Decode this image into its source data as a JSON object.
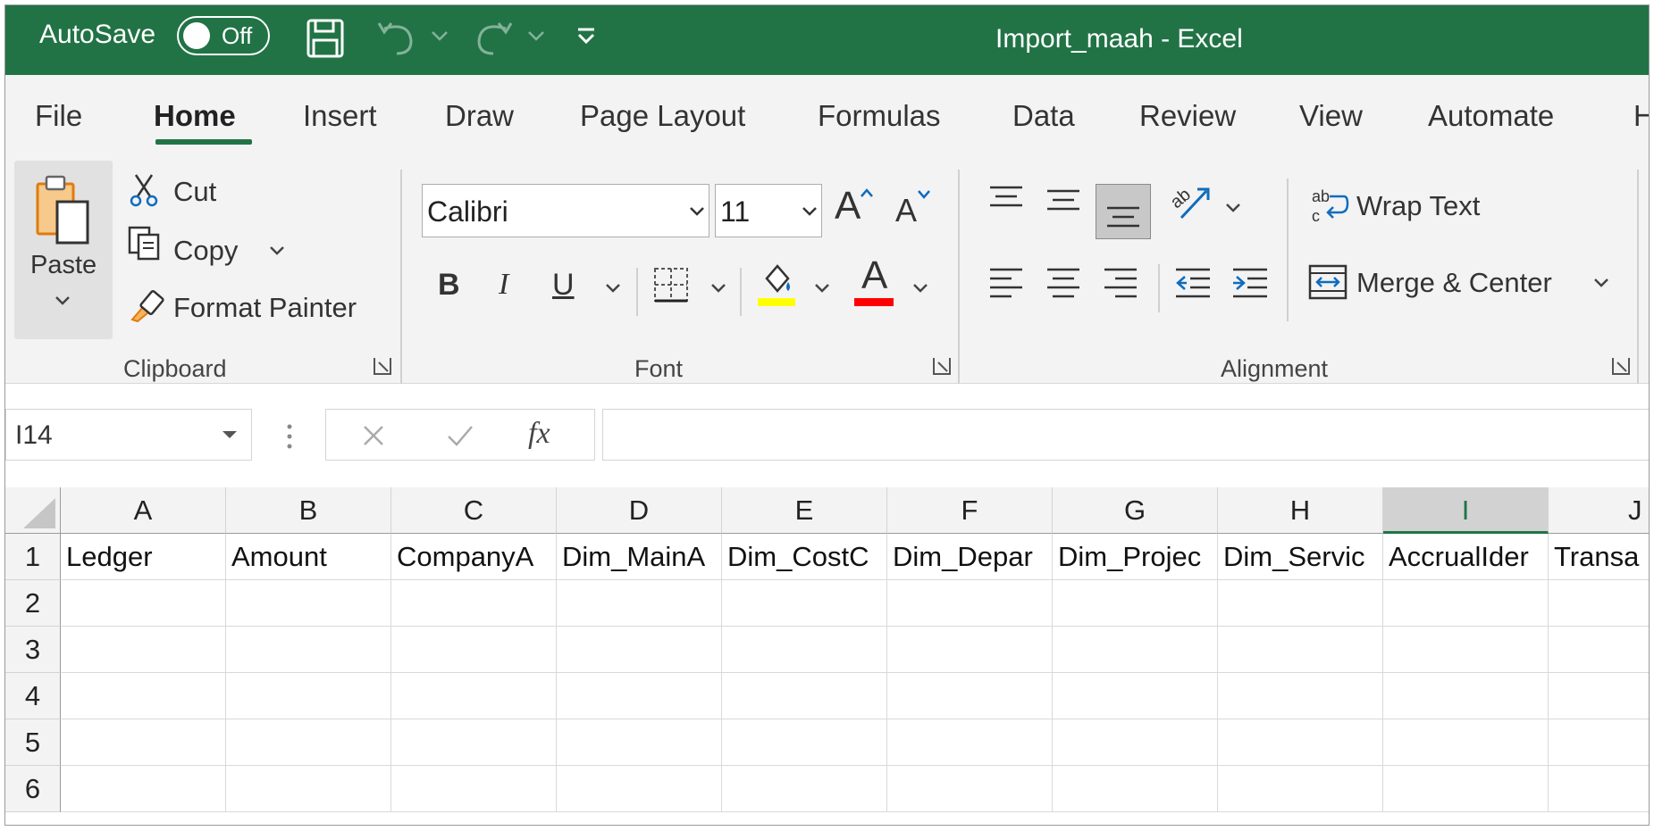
{
  "titlebar": {
    "autosave_label": "AutoSave",
    "autosave_state": "Off",
    "document_title": "Import_maah  -  Excel",
    "accent": "#217346"
  },
  "tabs": [
    "File",
    "Home",
    "Insert",
    "Draw",
    "Page Layout",
    "Formulas",
    "Data",
    "Review",
    "View",
    "Automate",
    "H"
  ],
  "active_tab": "Home",
  "ribbon": {
    "clipboard": {
      "group_label": "Clipboard",
      "paste": "Paste",
      "cut": "Cut",
      "copy": "Copy",
      "format_painter": "Format Painter"
    },
    "font": {
      "group_label": "Font",
      "font_name": "Calibri",
      "font_size": "11",
      "bold": "B",
      "italic": "I",
      "underline": "U",
      "grow": "A",
      "shrink": "A",
      "font_color_letter": "A",
      "highlight_color": "#ffff00",
      "font_color": "#ff0000"
    },
    "alignment": {
      "group_label": "Alignment",
      "wrap_text": "Wrap Text",
      "merge_center": "Merge & Center"
    }
  },
  "formula_bar": {
    "name_box": "I14",
    "fx": "fx",
    "formula": ""
  },
  "grid": {
    "columns": [
      "A",
      "B",
      "C",
      "D",
      "E",
      "F",
      "G",
      "H",
      "I",
      "J"
    ],
    "selected_column": "I",
    "rows": [
      "1",
      "2",
      "3",
      "4",
      "5",
      "6"
    ],
    "row1": [
      "Ledger",
      "Amount",
      "CompanyA",
      "Dim_MainA",
      "Dim_CostC",
      "Dim_Depar",
      "Dim_Projec",
      "Dim_Servic",
      "AccrualIder",
      "Transa"
    ]
  }
}
